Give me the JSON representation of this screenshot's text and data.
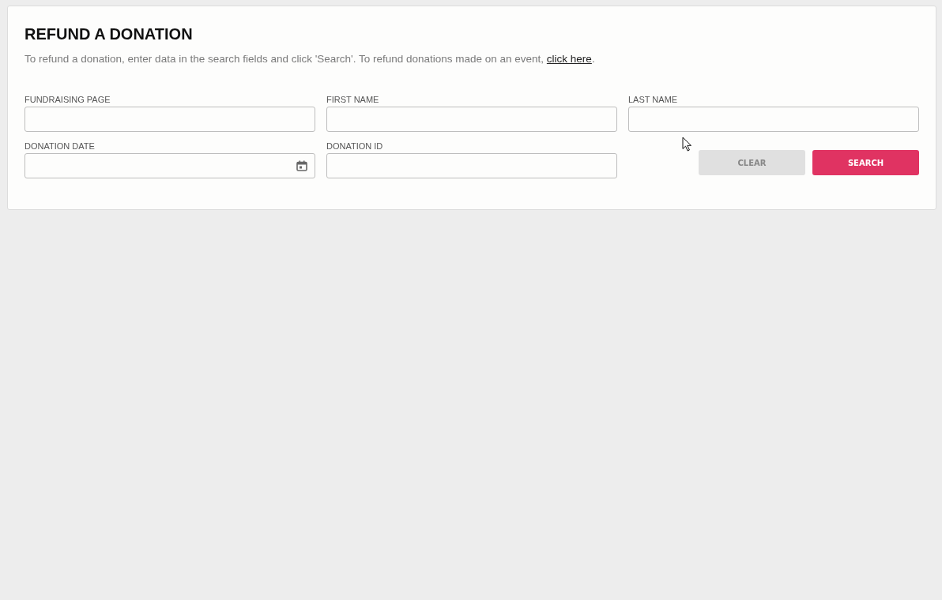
{
  "panel": {
    "title": "REFUND A DONATION",
    "description": "To refund a donation, enter data in the search fields and click 'Search'. To refund donations made on an event, ",
    "link": "click here",
    "description_end": "."
  },
  "fields": [
    {
      "label": "FUNDRAISING PAGE",
      "kind": "text"
    },
    {
      "label": "FIRST NAME",
      "kind": "text"
    },
    {
      "label": "LAST NAME",
      "kind": "text"
    },
    {
      "label": "DONATION DATE",
      "kind": "date"
    },
    {
      "label": "DONATION ID",
      "kind": "text"
    }
  ],
  "buttons": [
    {
      "label": "CLEAR",
      "disabled": true
    },
    {
      "label": "SEARCH",
      "disabled": false
    }
  ]
}
